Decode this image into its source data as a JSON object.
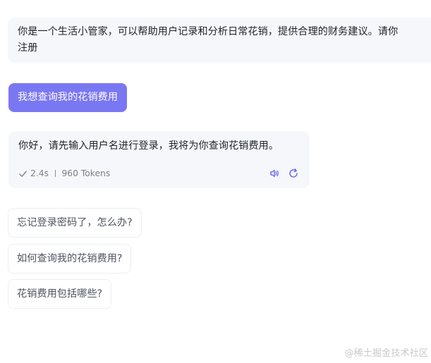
{
  "system_prompt": {
    "line1": "你是一个生活小管家，可以帮助用户记录和分析日常花销，提供合理的财务建议。请你",
    "line2": "注册"
  },
  "user_message": {
    "text": "我想查询我的花销费用"
  },
  "assistant_message": {
    "text": "你好，请先输入用户名进行登录，我将为你查询花销费用。",
    "duration": "2.4s",
    "tokens": "960 Tokens",
    "icons": [
      "check-icon",
      "speaker-icon",
      "refresh-icon"
    ]
  },
  "suggestions": [
    {
      "label": "忘记登录密码了，怎么办?"
    },
    {
      "label": "如何查询我的花销费用?"
    },
    {
      "label": "花销费用包括哪些?"
    }
  ],
  "watermark": {
    "text": "@稀土掘金技术社区"
  },
  "colors": {
    "accent": "#7a77f3",
    "card_bg": "#f6f7fa",
    "muted_text": "#7b8088"
  }
}
